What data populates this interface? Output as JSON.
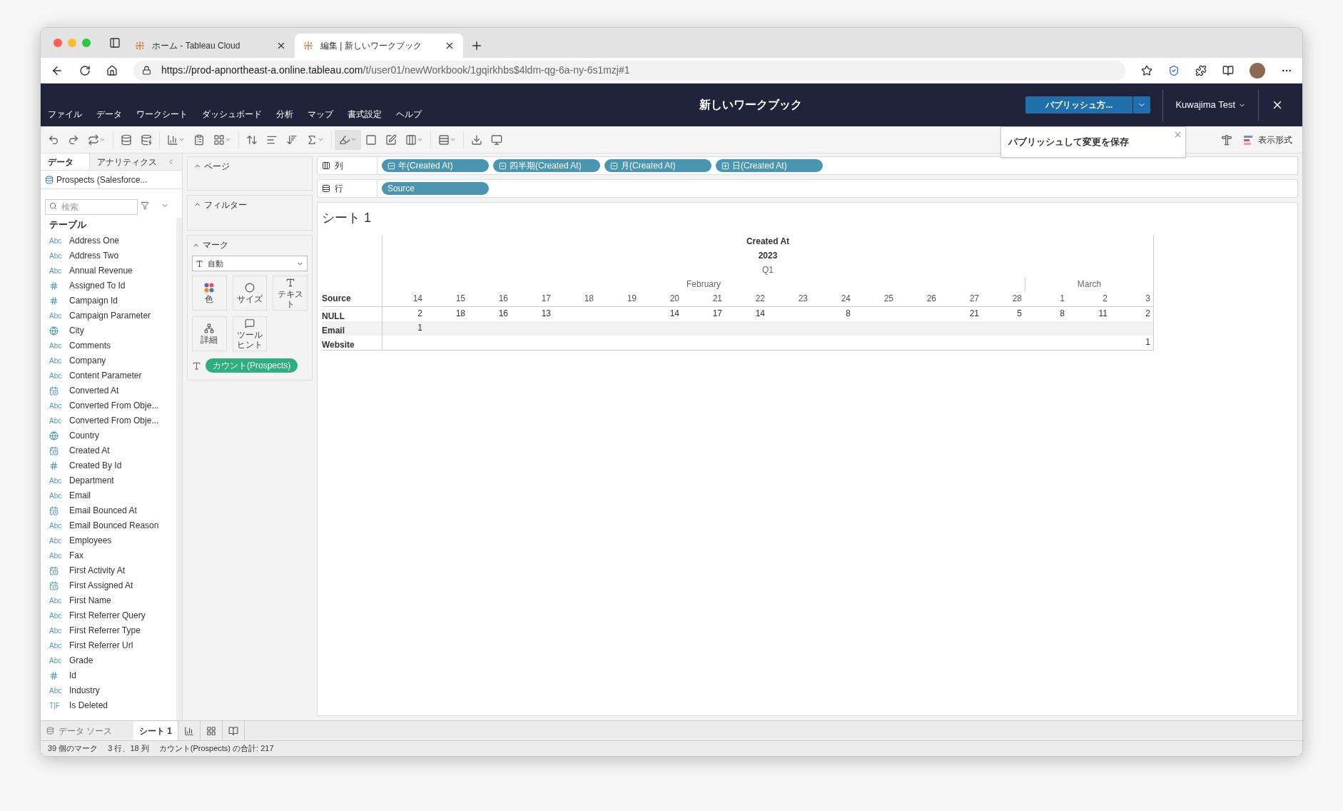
{
  "browser": {
    "tabs": [
      {
        "title": "ホーム - Tableau Cloud",
        "selected": false
      },
      {
        "title": "編集 | 新しいワークブック",
        "selected": true
      }
    ],
    "url": {
      "host": "https://prod-apnortheast-a.online.tableau.com",
      "path": "/t/user01/newWorkbook/1gqirkhbs$4ldm-qg-6a-ny-6s1mzj#1"
    }
  },
  "app": {
    "menu": [
      "ファイル",
      "データ",
      "ワークシート",
      "ダッシュボード",
      "分析",
      "マップ",
      "書式設定",
      "ヘルプ"
    ],
    "title": "新しいワークブック",
    "publish_button": "パブリッシュ方...",
    "user": "Kuwajima Test",
    "tooltip": "パブリッシュして変更を保存",
    "show_me": "表示形式"
  },
  "data_pane": {
    "tabs": [
      {
        "label": "データ",
        "selected": true
      },
      {
        "label": "アナリティクス",
        "selected": false
      }
    ],
    "datasource": "Prospects (Salesforce...",
    "search": {
      "placeholder": "検索"
    },
    "section": "テーブル",
    "fields": [
      {
        "name": "Address One",
        "kind": "string",
        "badge": "Abc"
      },
      {
        "name": "Address Two",
        "kind": "string",
        "badge": "Abc"
      },
      {
        "name": "Annual Revenue",
        "kind": "string",
        "badge": "Abc"
      },
      {
        "name": "Assigned To Id",
        "kind": "number"
      },
      {
        "name": "Campaign Id",
        "kind": "number"
      },
      {
        "name": "Campaign Parameter",
        "kind": "string",
        "badge": "Abc"
      },
      {
        "name": "City",
        "kind": "geo"
      },
      {
        "name": "Comments",
        "kind": "string",
        "badge": "Abc"
      },
      {
        "name": "Company",
        "kind": "string",
        "badge": "Abc"
      },
      {
        "name": "Content Parameter",
        "kind": "string",
        "badge": "Abc"
      },
      {
        "name": "Converted At",
        "kind": "date"
      },
      {
        "name": "Converted From Obje...",
        "kind": "string",
        "badge": "Abc"
      },
      {
        "name": "Converted From Obje...",
        "kind": "string",
        "badge": "Abc"
      },
      {
        "name": "Country",
        "kind": "geo"
      },
      {
        "name": "Created At",
        "kind": "date"
      },
      {
        "name": "Created By Id",
        "kind": "number"
      },
      {
        "name": "Department",
        "kind": "string",
        "badge": "Abc"
      },
      {
        "name": "Email",
        "kind": "string",
        "badge": "Abc"
      },
      {
        "name": "Email Bounced At",
        "kind": "date"
      },
      {
        "name": "Email Bounced Reason",
        "kind": "string",
        "badge": "Abc"
      },
      {
        "name": "Employees",
        "kind": "string",
        "badge": "Abc"
      },
      {
        "name": "Fax",
        "kind": "string",
        "badge": "Abc"
      },
      {
        "name": "First Activity At",
        "kind": "date"
      },
      {
        "name": "First Assigned At",
        "kind": "date"
      },
      {
        "name": "First Name",
        "kind": "string",
        "badge": "Abc"
      },
      {
        "name": "First Referrer Query",
        "kind": "string",
        "badge": "Abc"
      },
      {
        "name": "First Referrer Type",
        "kind": "string",
        "badge": "Abc"
      },
      {
        "name": "First Referrer Url",
        "kind": "string",
        "badge": "Abc"
      },
      {
        "name": "Grade",
        "kind": "string",
        "badge": "Abc"
      },
      {
        "name": "Id",
        "kind": "number"
      },
      {
        "name": "Industry",
        "kind": "string",
        "badge": "Abc"
      },
      {
        "name": "Is Deleted",
        "kind": "bool",
        "badge": "T|F"
      }
    ]
  },
  "cards": {
    "pages": "ページ",
    "filters": "フィルター",
    "marks": {
      "title": "マーク",
      "type": "自動",
      "buttons": [
        {
          "label": "色",
          "kind": "color"
        },
        {
          "label": "サイズ",
          "kind": "size"
        },
        {
          "label": "テキスト",
          "kind": "text"
        },
        {
          "label": "詳細",
          "kind": "detail"
        },
        {
          "label": "ツールヒント",
          "kind": "tooltip"
        }
      ],
      "pill": "カウント(Prospects)"
    }
  },
  "shelves": {
    "columns": {
      "label": "列",
      "pills": [
        {
          "label": "年(Created At)",
          "expanded": true
        },
        {
          "label": "四半期(Created At)",
          "expanded": true
        },
        {
          "label": "月(Created At)",
          "expanded": true
        },
        {
          "label": "日(Created At)",
          "expanded": false
        }
      ]
    },
    "rows": {
      "label": "行",
      "pills": [
        {
          "label": "Source"
        }
      ]
    }
  },
  "sheet": {
    "title": "シート 1",
    "headers": [
      "Created At",
      "2023",
      "Q1"
    ],
    "months": [
      {
        "label": "February",
        "days": [
          "14",
          "15",
          "16",
          "17",
          "18",
          "19",
          "20",
          "21",
          "22",
          "23",
          "24",
          "25",
          "26",
          "27",
          "28"
        ]
      },
      {
        "label": "March",
        "days": [
          "1",
          "2",
          "3"
        ]
      }
    ],
    "row_header": "Source",
    "rows": [
      {
        "label": "NULL",
        "cells": [
          {
            "kind": "count",
            "text": "2"
          },
          {
            "kind": "count",
            "text": "18"
          },
          {
            "kind": "count",
            "text": "16"
          },
          {
            "kind": "count",
            "text": "13"
          },
          {
            "kind": "blank"
          },
          {
            "kind": "blank"
          },
          {
            "kind": "count",
            "text": "14"
          },
          {
            "kind": "count",
            "text": "17"
          },
          {
            "kind": "count",
            "text": "14"
          },
          {
            "kind": "blank"
          },
          {
            "kind": "count",
            "text": "8"
          },
          {
            "kind": "blank"
          },
          {
            "kind": "blank"
          },
          {
            "kind": "count",
            "text": "21"
          },
          {
            "kind": "count",
            "text": "5"
          },
          {
            "kind": "count",
            "text": "8"
          },
          {
            "kind": "count",
            "text": "11"
          },
          {
            "kind": "count",
            "text": "2"
          }
        ]
      },
      {
        "label": "Email",
        "cells": [
          {
            "kind": "count",
            "text": "1"
          },
          {
            "kind": "blank"
          },
          {
            "kind": "blank"
          },
          {
            "kind": "blank"
          },
          {
            "kind": "blank"
          },
          {
            "kind": "blank"
          },
          {
            "kind": "blank"
          },
          {
            "kind": "blank"
          },
          {
            "kind": "blank"
          },
          {
            "kind": "blank"
          },
          {
            "kind": "blank"
          },
          {
            "kind": "blank"
          },
          {
            "kind": "blank"
          },
          {
            "kind": "blank"
          },
          {
            "kind": "blank"
          },
          {
            "kind": "blank"
          },
          {
            "kind": "blank"
          },
          {
            "kind": "blank"
          }
        ]
      },
      {
        "label": "Website",
        "cells": [
          {
            "kind": "blank"
          },
          {
            "kind": "blank"
          },
          {
            "kind": "blank"
          },
          {
            "kind": "blank"
          },
          {
            "kind": "blank"
          },
          {
            "kind": "blank"
          },
          {
            "kind": "blank"
          },
          {
            "kind": "blank"
          },
          {
            "kind": "blank"
          },
          {
            "kind": "blank"
          },
          {
            "kind": "blank"
          },
          {
            "kind": "blank"
          },
          {
            "kind": "blank"
          },
          {
            "kind": "blank"
          },
          {
            "kind": "blank"
          },
          {
            "kind": "blank"
          },
          {
            "kind": "blank"
          },
          {
            "kind": "count",
            "text": "1"
          }
        ]
      }
    ]
  },
  "sheet_tabs": [
    {
      "label": "データ ソース",
      "kind": "datasource",
      "selected": false
    },
    {
      "label": "シート 1",
      "kind": "sheet",
      "selected": true
    }
  ],
  "status": [
    "39 個のマーク",
    "3 行、18 列",
    "カウント(Prospects) の合計: 217"
  ]
}
